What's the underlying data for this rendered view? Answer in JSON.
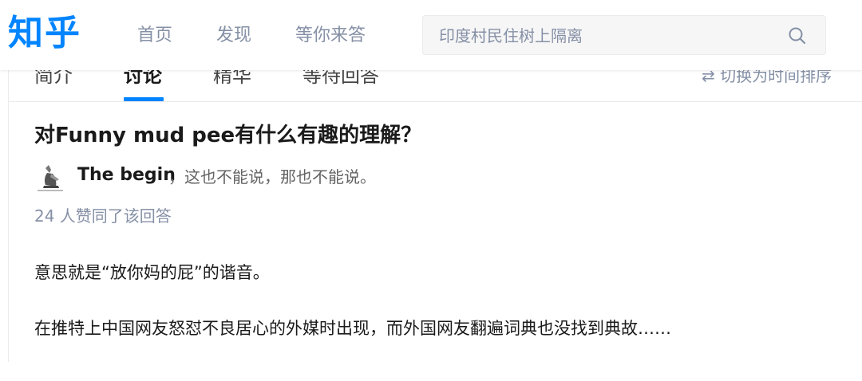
{
  "header": {
    "logo": "知乎",
    "nav": [
      "首页",
      "发现",
      "等你来答"
    ],
    "search": {
      "placeholder": "印度村民住树上隔离"
    }
  },
  "tabs": {
    "items": [
      "简介",
      "讨论",
      "精华",
      "等待回答"
    ],
    "active": "讨论",
    "sort_label": "⇄ 切换为时间排序"
  },
  "answer": {
    "question_title": "对Funny mud pee有什么有趣的理解？",
    "author_name": "The begin",
    "author_bio": "，这也不能说，那也不能说。",
    "vote_text": "24 人赞同了该回答",
    "paragraphs": [
      "意思就是“放你妈的屁”的谐音。",
      "在推特上中国网友怒怼不良居心的外媒时出现，而外国网友翻遍词典也没找到典故……"
    ]
  },
  "colors": {
    "brand": "#0084ff",
    "meta_gray": "#8590a6"
  }
}
